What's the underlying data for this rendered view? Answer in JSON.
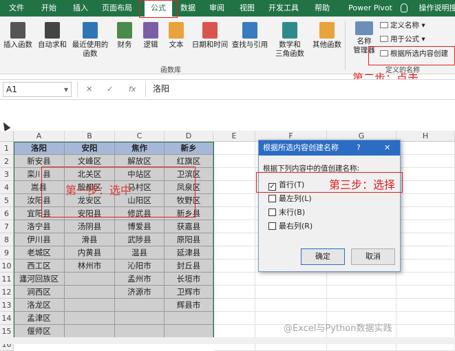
{
  "tabs": [
    {
      "label": "文件",
      "active": false
    },
    {
      "label": "开始",
      "active": false
    },
    {
      "label": "插入",
      "active": false
    },
    {
      "label": "页面布局",
      "active": false
    },
    {
      "label": "公式",
      "active": true
    },
    {
      "label": "数据",
      "active": false
    },
    {
      "label": "审阅",
      "active": false
    },
    {
      "label": "视图",
      "active": false
    },
    {
      "label": "开发工具",
      "active": false
    },
    {
      "label": "帮助",
      "active": false
    },
    {
      "label": "Power Pivot",
      "active": false
    },
    {
      "label": "操作说明搜",
      "active": false
    }
  ],
  "tell_me_icon": "lightbulb-icon",
  "ribbon": {
    "buttons": [
      {
        "label": "插入函数",
        "icon": "fx-icon",
        "color": "#555555"
      },
      {
        "label": "自动求和",
        "icon": "sigma-icon",
        "color": "#444444"
      },
      {
        "label": "最近使用的\n函数",
        "icon": "star-book-icon",
        "color": "#2e75b6"
      },
      {
        "label": "财务",
        "icon": "finance-book-icon",
        "color": "#4a8a4a"
      },
      {
        "label": "逻辑",
        "icon": "question-book-icon",
        "color": "#7b5ea7"
      },
      {
        "label": "文本",
        "icon": "text-book-icon",
        "color": "#e8a33c"
      },
      {
        "label": "日期和时间",
        "icon": "calendar-book-icon",
        "color": "#d9534f"
      },
      {
        "label": "查找与引用",
        "icon": "lookup-book-icon",
        "color": "#3a7abf"
      },
      {
        "label": "数学和\n三角函数",
        "icon": "theta-book-icon",
        "color": "#2e8b8b"
      },
      {
        "label": "其他函数",
        "icon": "more-book-icon",
        "color": "#e8a33c"
      }
    ],
    "group_label": "函数库",
    "name_manager": "名称\n管理器",
    "defined_names": {
      "define_name": "定义名称",
      "use_in_formula": "用于公式",
      "create_from_selection": "根据所选内容创建",
      "group_label": "定义的名称"
    }
  },
  "annotations": {
    "step1": "第一步：选中",
    "step2": "第二步：点击",
    "step3": "第三步：选择"
  },
  "formula_bar": {
    "name_box": "A1",
    "cancel": "✕",
    "confirm": "✓",
    "fx": "fx",
    "value": "洛阳"
  },
  "columns": [
    "A",
    "B",
    "C",
    "D",
    "E",
    "F",
    "G",
    "H"
  ],
  "rows": [
    "1",
    "2",
    "3",
    "4",
    "5",
    "6",
    "7",
    "8",
    "9",
    "10",
    "11",
    "12",
    "13",
    "14",
    "15",
    "16"
  ],
  "table": [
    [
      "洛阳",
      "安阳",
      "焦作",
      "新乡"
    ],
    [
      "新安县",
      "文峰区",
      "解放区",
      "红旗区"
    ],
    [
      "栾川县",
      "北关区",
      "中站区",
      "卫滨区"
    ],
    [
      "嵩县",
      "殷都区",
      "马村区",
      "凤泉区"
    ],
    [
      "汝阳县",
      "龙安区",
      "山阳区",
      "牧野区"
    ],
    [
      "宜阳县",
      "安阳县",
      "修武县",
      "新乡县"
    ],
    [
      "洛宁县",
      "汤阴县",
      "博爱县",
      "获嘉县"
    ],
    [
      "伊川县",
      "滑县",
      "武陟县",
      "原阳县"
    ],
    [
      "老城区",
      "内黄县",
      "温县",
      "延津县"
    ],
    [
      "西工区",
      "林州市",
      "沁阳市",
      "封丘县"
    ],
    [
      "瀍河回族区",
      "",
      "孟州市",
      "长垣市"
    ],
    [
      "涧西区",
      "",
      "济源市",
      "卫辉市"
    ],
    [
      "洛龙区",
      "",
      "",
      "辉县市"
    ],
    [
      "孟津区",
      "",
      "",
      ""
    ],
    [
      "偃师区",
      "",
      "",
      ""
    ]
  ],
  "dialog": {
    "title": "根据所选内容创建名称",
    "help": "?",
    "close": "✕",
    "prompt": "根据下列内容中的值创建名称:",
    "options": [
      {
        "label": "首行(T)",
        "checked": true
      },
      {
        "label": "最左列(L)",
        "checked": false
      },
      {
        "label": "末行(B)",
        "checked": false
      },
      {
        "label": "最右列(R)",
        "checked": false
      }
    ],
    "ok": "确定",
    "cancel": "取消"
  },
  "watermark": "@Excel与Python数据实践"
}
